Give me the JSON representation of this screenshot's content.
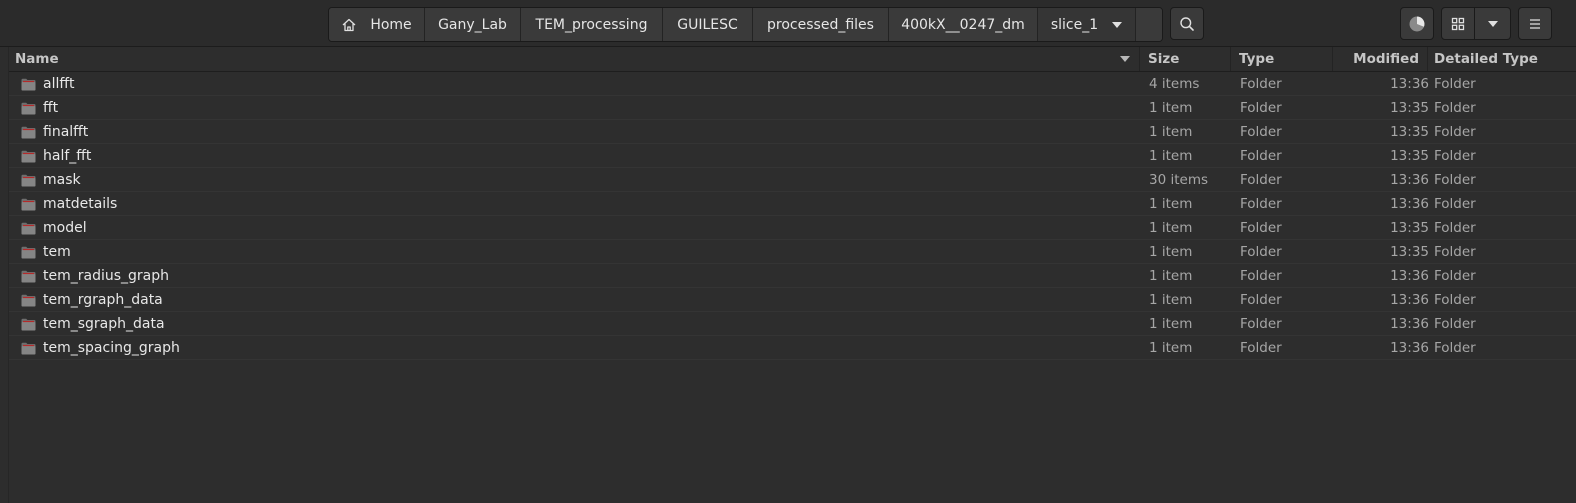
{
  "pathbar": {
    "crumbs": [
      {
        "label": "Home"
      },
      {
        "label": "Gany_Lab"
      },
      {
        "label": "TEM_processing"
      },
      {
        "label": "GUILESC"
      },
      {
        "label": "processed_files"
      },
      {
        "label": "400kX__0247_dm"
      },
      {
        "label": "slice_1"
      }
    ]
  },
  "toolbar": {
    "search_icon": "search-icon",
    "progress_icon": "pie-progress-icon",
    "view_icon": "grid-view-icon",
    "view_menu_icon": "chevron-down-icon",
    "main_menu_icon": "hamburger-icon"
  },
  "columns": {
    "name": "Name",
    "size": "Size",
    "type": "Type",
    "modified": "Modified",
    "detailed_type": "Detailed Type"
  },
  "files": [
    {
      "name": "allfft",
      "size": "4 items",
      "type": "Folder",
      "modified": "13:36",
      "detailed_type": "Folder"
    },
    {
      "name": "fft",
      "size": "1 item",
      "type": "Folder",
      "modified": "13:35",
      "detailed_type": "Folder"
    },
    {
      "name": "finalfft",
      "size": "1 item",
      "type": "Folder",
      "modified": "13:35",
      "detailed_type": "Folder"
    },
    {
      "name": "half_fft",
      "size": "1 item",
      "type": "Folder",
      "modified": "13:35",
      "detailed_type": "Folder"
    },
    {
      "name": "mask",
      "size": "30 items",
      "type": "Folder",
      "modified": "13:36",
      "detailed_type": "Folder"
    },
    {
      "name": "matdetails",
      "size": "1 item",
      "type": "Folder",
      "modified": "13:36",
      "detailed_type": "Folder"
    },
    {
      "name": "model",
      "size": "1 item",
      "type": "Folder",
      "modified": "13:35",
      "detailed_type": "Folder"
    },
    {
      "name": "tem",
      "size": "1 item",
      "type": "Folder",
      "modified": "13:35",
      "detailed_type": "Folder"
    },
    {
      "name": "tem_radius_graph",
      "size": "1 item",
      "type": "Folder",
      "modified": "13:36",
      "detailed_type": "Folder"
    },
    {
      "name": "tem_rgraph_data",
      "size": "1 item",
      "type": "Folder",
      "modified": "13:36",
      "detailed_type": "Folder"
    },
    {
      "name": "tem_sgraph_data",
      "size": "1 item",
      "type": "Folder",
      "modified": "13:36",
      "detailed_type": "Folder"
    },
    {
      "name": "tem_spacing_graph",
      "size": "1 item",
      "type": "Folder",
      "modified": "13:36",
      "detailed_type": "Folder"
    }
  ],
  "colors": {
    "background": "#2d2d2d",
    "headerbar": "#2b2b2b",
    "button": "#3a3a3a",
    "text": "#e8e8e8",
    "muted_text": "#a6a6a6",
    "folder_accent": "#b52a2a"
  }
}
